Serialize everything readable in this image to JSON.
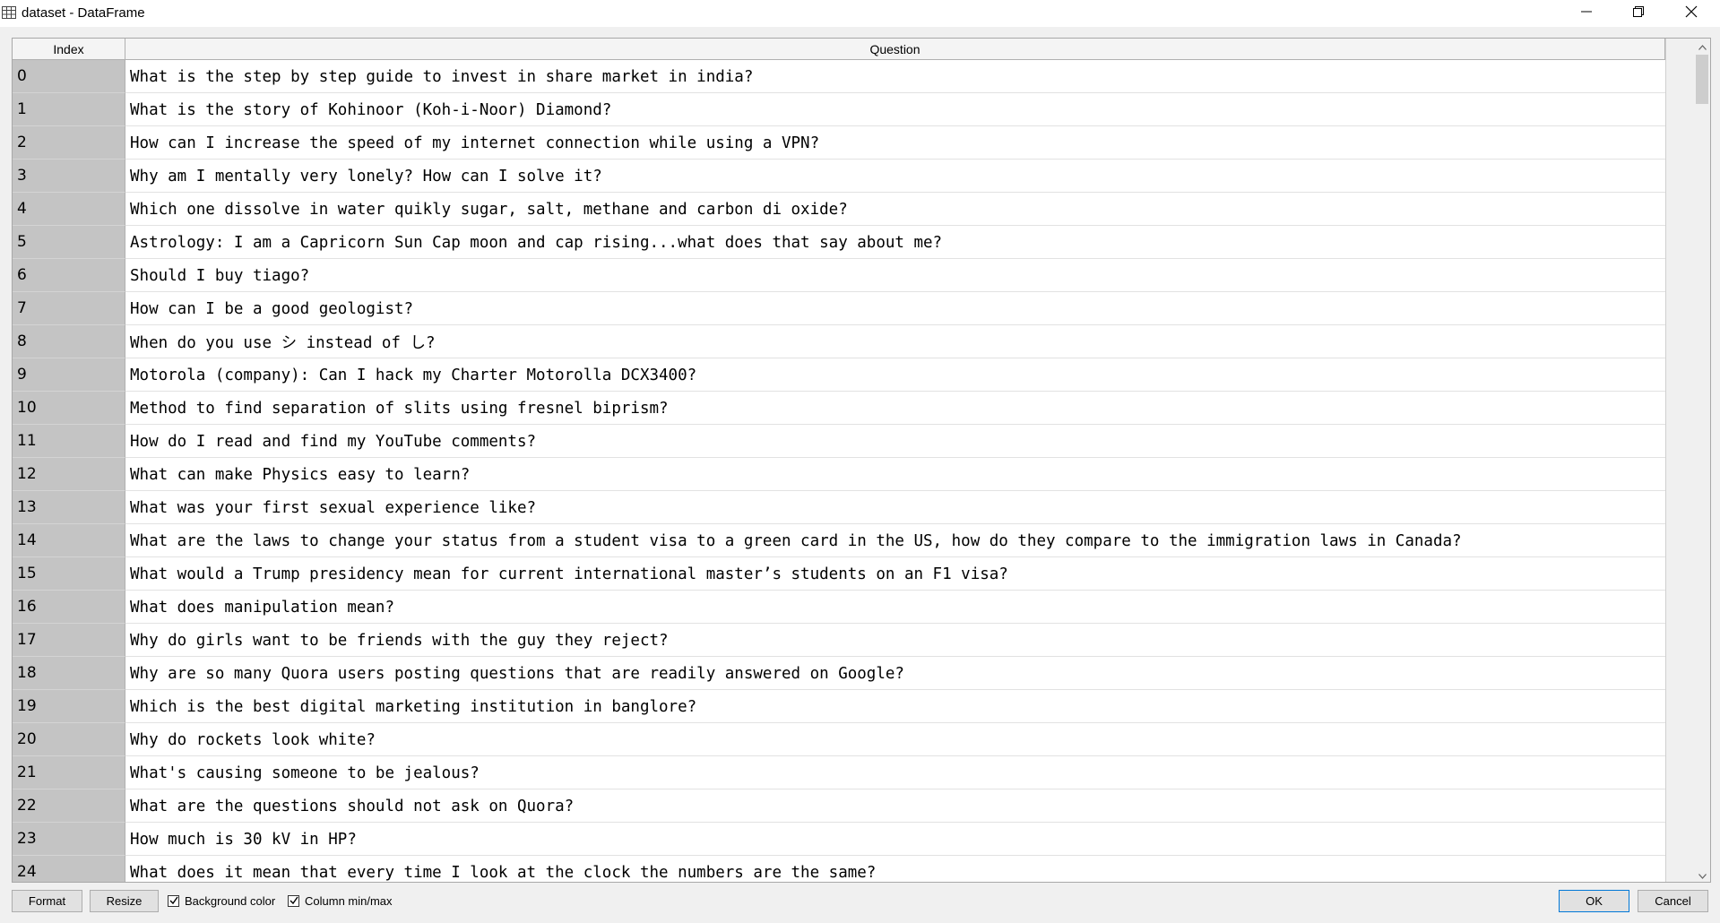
{
  "window": {
    "title": "dataset - DataFrame",
    "icons": [
      "table-icon",
      "minimize-icon",
      "maximize-icon",
      "close-icon"
    ]
  },
  "table": {
    "columns": [
      "Index",
      "Question"
    ],
    "rows": [
      {
        "index": "0",
        "question": "What is the step by step guide to invest in share market in india?"
      },
      {
        "index": "1",
        "question": "What is the story of Kohinoor (Koh-i-Noor) Diamond?"
      },
      {
        "index": "2",
        "question": "How can I increase the speed of my internet connection while using a VPN?"
      },
      {
        "index": "3",
        "question": "Why am I mentally very lonely? How can I solve it?"
      },
      {
        "index": "4",
        "question": "Which one dissolve in water quikly sugar, salt, methane and carbon di oxide?"
      },
      {
        "index": "5",
        "question": "Astrology: I am a Capricorn Sun Cap moon and cap rising...what does that say about me?"
      },
      {
        "index": "6",
        "question": "Should I buy tiago?"
      },
      {
        "index": "7",
        "question": "How can I be a good geologist?"
      },
      {
        "index": "8",
        "question": "When do you use シ instead of し?"
      },
      {
        "index": "9",
        "question": "Motorola (company): Can I hack my Charter Motorolla DCX3400?"
      },
      {
        "index": "10",
        "question": "Method to find separation of slits using fresnel biprism?"
      },
      {
        "index": "11",
        "question": "How do I read and find my YouTube comments?"
      },
      {
        "index": "12",
        "question": "What can make Physics easy to learn?"
      },
      {
        "index": "13",
        "question": "What was your first sexual experience like?"
      },
      {
        "index": "14",
        "question": "What are the laws to change your status from a student visa to a green card in the US, how do they compare to the immigration laws in Canada?"
      },
      {
        "index": "15",
        "question": "What would a Trump presidency mean for current international master’s students on an F1 visa?"
      },
      {
        "index": "16",
        "question": "What does manipulation mean?"
      },
      {
        "index": "17",
        "question": "Why do girls want to be friends with the guy they reject?"
      },
      {
        "index": "18",
        "question": "Why are so many Quora users posting questions that are readily answered on Google?"
      },
      {
        "index": "19",
        "question": "Which is the best digital marketing institution in banglore?"
      },
      {
        "index": "20",
        "question": "Why do rockets look white?"
      },
      {
        "index": "21",
        "question": "What's causing someone to be jealous?"
      },
      {
        "index": "22",
        "question": "What are the questions should not ask on Quora?"
      },
      {
        "index": "23",
        "question": "How much is 30 kV in HP?"
      },
      {
        "index": "24",
        "question": "What does it mean that every time I look at the clock the numbers are the same?"
      }
    ]
  },
  "bottombar": {
    "format_label": "Format",
    "resize_label": "Resize",
    "background_color_label": "Background color",
    "background_color_checked": true,
    "column_minmax_label": "Column min/max",
    "column_minmax_checked": true,
    "ok_label": "OK",
    "cancel_label": "Cancel"
  }
}
